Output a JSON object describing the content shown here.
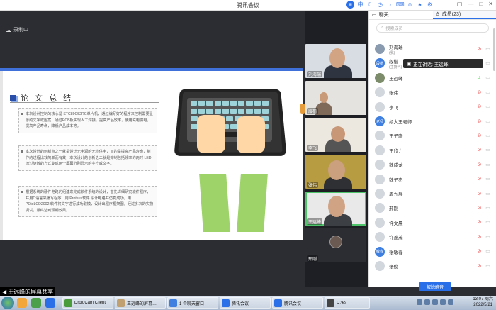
{
  "window": {
    "title": "腾讯会议"
  },
  "main": {
    "recording_label": "录制中"
  },
  "slide": {
    "title": "论 文 总 结",
    "paragraphs": [
      "本次设计控制的核心是 STC89C52RC单片机，通过编写好的程序来控制需要显示的文字或图案，通过PCB板实现人工焊接，提高产品效率，使用充电供电，提高产品寿命，降低产品成本等。",
      "本次设计的创新点之一就是设计无电源的无线供电，目的是提高产品寿命，制作的过程比较简单而有效，本次设计的创新之二就是抑制包括频率的两时 LED 流过旋转的方式变成两个屏幕分别显示的字符或文字。",
      "根据系统的硬件电路的组建来完成软件系统的设计，首先详细研究软件程序，并用C语言来编写程序，用 Proteus软件 设计电路并仿真成功，用 PCtoLCD2002 软件将文字进行成功取模，设计出程序框架图，经过多次的实物调试，最终达到预期效果。"
    ]
  },
  "thumbnails": [
    {
      "name": "刘海瑞"
    },
    {
      "name": "段楷"
    },
    {
      "name": "李飞"
    },
    {
      "name": "张伟"
    },
    {
      "name": "王远峰"
    },
    {
      "name": "邢刚"
    }
  ],
  "panel": {
    "tab_chat": "聊天",
    "tab_members": "成员(23)",
    "search_placeholder": "搜索成员",
    "speaking": "正在讲话: 王远峰;",
    "unmute_all": "解除静音",
    "members": [
      {
        "name": "刘海瑞",
        "sub": "(我)",
        "avatar": "",
        "color": "#8a9bb0"
      },
      {
        "name": "段楷",
        "sub": "(主持人)",
        "avatar": "段楷",
        "color": "#3f7fe0"
      },
      {
        "name": "王远峰",
        "sub": "",
        "avatar": "",
        "color": "#7d8c6b"
      },
      {
        "name": "张伟",
        "sub": "",
        "avatar": "",
        "color": "#d2d6dd"
      },
      {
        "name": "李飞",
        "sub": "",
        "avatar": "",
        "color": "#d2d6dd"
      },
      {
        "name": "胡大王老师",
        "sub": "",
        "avatar": "老师",
        "color": "#3f7fe0"
      },
      {
        "name": "王子骁",
        "sub": "",
        "avatar": "",
        "color": "#d2d6dd"
      },
      {
        "name": "王欣力",
        "sub": "",
        "avatar": "",
        "color": "#d2d6dd"
      },
      {
        "name": "魏成龙",
        "sub": "",
        "avatar": "",
        "color": "#d2d6dd"
      },
      {
        "name": "魏子杰",
        "sub": "",
        "avatar": "",
        "color": "#d2d6dd"
      },
      {
        "name": "周九展",
        "sub": "",
        "avatar": "",
        "color": "#d2d6dd"
      },
      {
        "name": "邢刚",
        "sub": "",
        "avatar": "",
        "color": "#d2d6dd"
      },
      {
        "name": "许文晨",
        "sub": "",
        "avatar": "",
        "color": "#d2d6dd"
      },
      {
        "name": "许菱茂",
        "sub": "",
        "avatar": "",
        "color": "#d2d6dd"
      },
      {
        "name": "张敏春",
        "sub": "",
        "avatar": "敏春",
        "color": "#3f7fe0"
      },
      {
        "name": "张俊",
        "sub": "",
        "avatar": "",
        "color": "#d2d6dd"
      }
    ]
  },
  "share_label": "王远峰的屏幕共享",
  "taskbar": {
    "buttons": [
      "DroidCam Client",
      "王远峰的屏幕…",
      "1 个聊天窗口",
      "腾讯会议",
      "腾讯会议",
      "D:\\es"
    ],
    "time": "13:07 周六",
    "date": "2022/5/21"
  }
}
